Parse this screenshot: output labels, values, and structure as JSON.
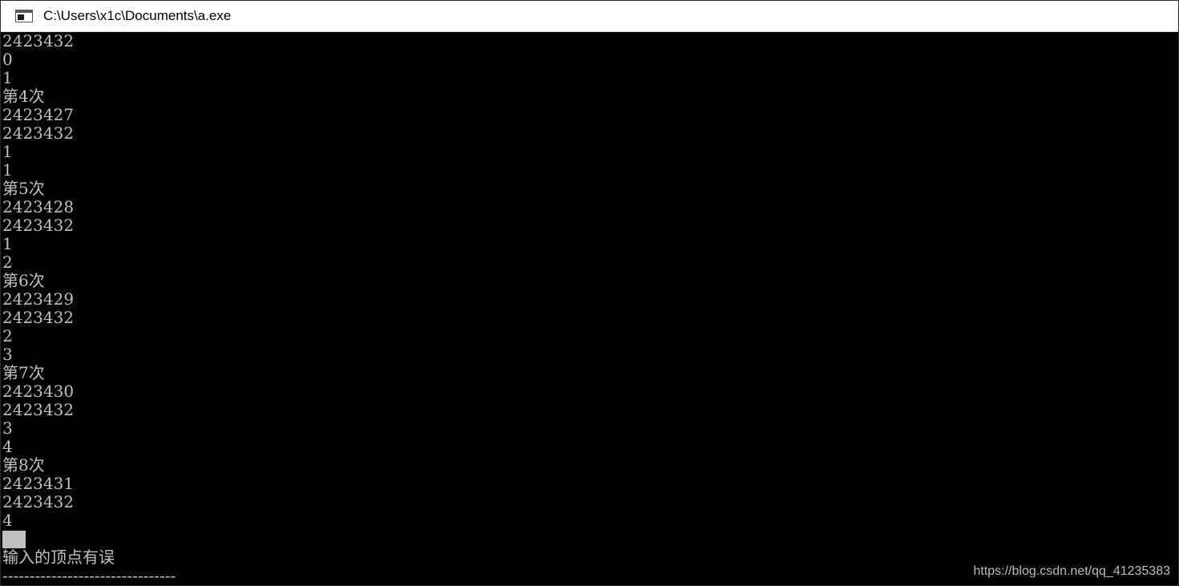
{
  "window": {
    "title": "C:\\Users\\x1c\\Documents\\a.exe",
    "icon": "console-window-icon"
  },
  "console": {
    "lines": [
      "2423432",
      "0",
      "1",
      "第4次",
      "2423427",
      "2423432",
      "1",
      "1",
      "第5次",
      "2423428",
      "2423432",
      "1",
      "2",
      "第6次",
      "2423429",
      "2423432",
      "2",
      "3",
      "第7次",
      "2423430",
      "2423432",
      "3",
      "4",
      "第8次",
      "2423431",
      "2423432",
      "4"
    ],
    "after_cursor_lines": [
      "输入的顶点有误",
      "--------------------------------"
    ]
  },
  "watermark": "https://blog.csdn.net/qq_41235383",
  "colors": {
    "console_bg": "#000000",
    "console_text": "#c0c0c0",
    "titlebar_bg": "#ffffff"
  }
}
